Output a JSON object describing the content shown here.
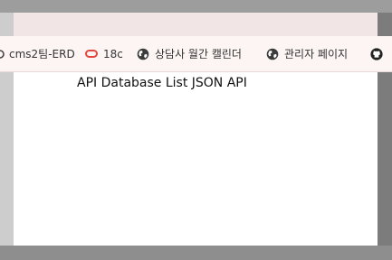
{
  "bookmarks": {
    "items": [
      {
        "label": "cms2팀-ERD",
        "icon": "bookmark-icon"
      },
      {
        "label": "18c",
        "icon": "oracle-icon"
      },
      {
        "label": "상담사 월간 캘린더",
        "icon": "globe-icon"
      },
      {
        "label": "관리자 페이지",
        "icon": "globe-icon"
      },
      {
        "label": "",
        "icon": "github-icon"
      }
    ]
  },
  "page": {
    "heading": "API Database List JSON API"
  },
  "colors": {
    "oracle_red": "#e2473f",
    "backdrop": "#b3b3b3"
  }
}
